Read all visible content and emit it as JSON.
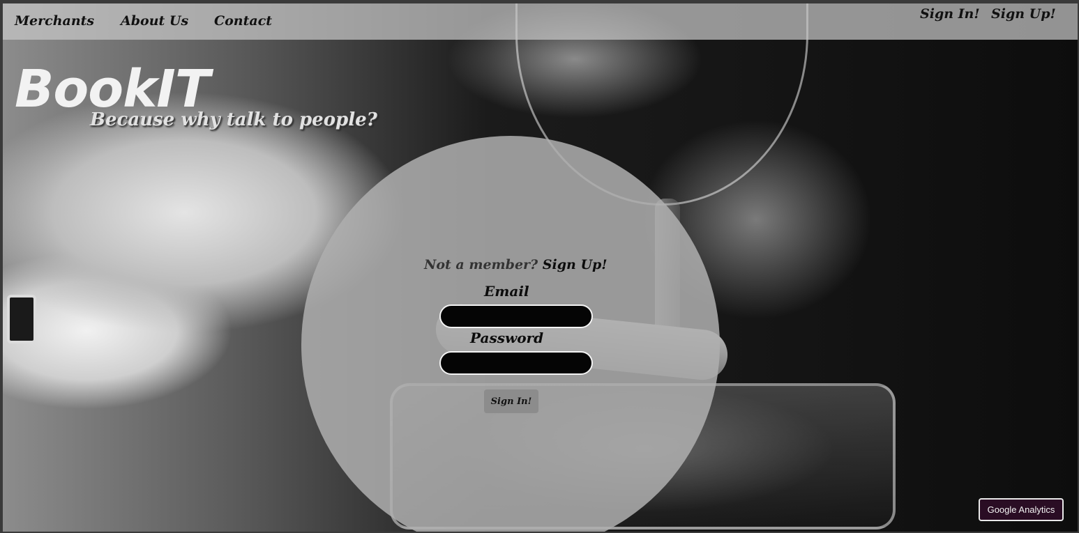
{
  "nav": {
    "merchants": "Merchants",
    "about": "About Us",
    "contact": "Contact",
    "sign_in": "Sign In!",
    "sign_up": "Sign Up!"
  },
  "hero": {
    "brand": "BookIT",
    "tagline": "Because why talk to people?"
  },
  "login": {
    "prompt": "Not a member?",
    "signup_link": "Sign Up!",
    "email_label": "Email",
    "email_value": "",
    "password_label": "Password",
    "password_value": "",
    "submit_label": "Sign In!"
  },
  "badge": {
    "label": "Google Analytics"
  }
}
